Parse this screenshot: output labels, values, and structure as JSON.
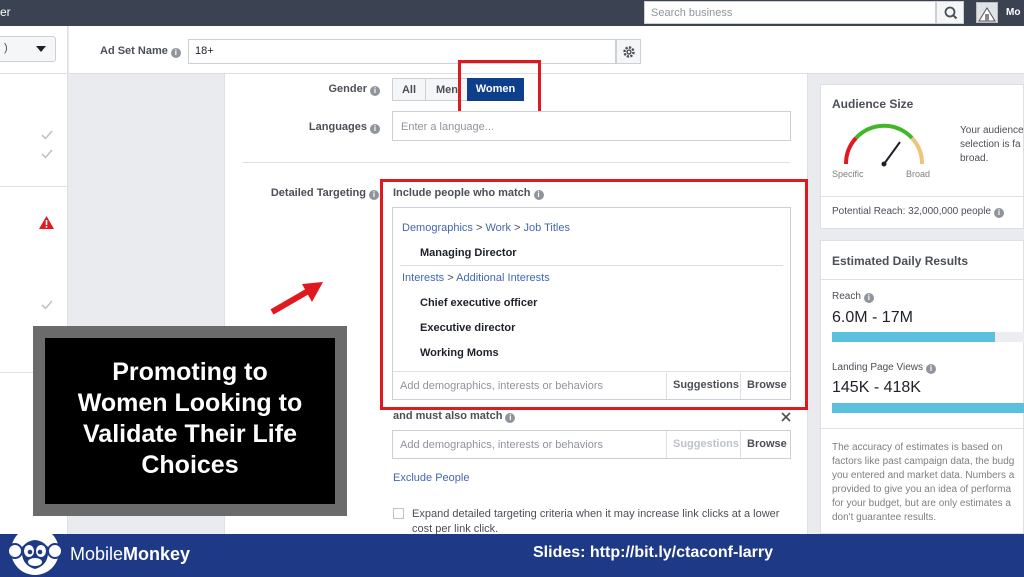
{
  "topbar": {
    "brand_fragment": "er",
    "search_placeholder": "Search business",
    "user_fragment": "Mo"
  },
  "adset": {
    "label": "Ad Set Name",
    "value": "18+"
  },
  "gender": {
    "label": "Gender",
    "options": [
      "All",
      "Men",
      "Women"
    ],
    "selected": "Women"
  },
  "languages": {
    "label": "Languages",
    "placeholder": "Enter a language..."
  },
  "detailed_targeting": {
    "label": "Detailed Targeting",
    "include_label": "Include people who match",
    "demo_path": [
      "Demographics",
      "Work",
      "Job Titles"
    ],
    "demo_items": [
      "Managing Director"
    ],
    "interest_path": [
      "Interests",
      "Additional Interests"
    ],
    "interest_items": [
      "Chief executive officer",
      "Executive director",
      "Working Moms"
    ],
    "add_placeholder": "Add demographics, interests or behaviors",
    "suggestions": "Suggestions",
    "browse": "Browse",
    "must_also_label": "and must also match",
    "exclude_link": "Exclude People",
    "expand_text": "Expand detailed targeting criteria when it may increase link clicks at a lower cost per link click."
  },
  "audience_size": {
    "title": "Audience Size",
    "gauge_specific": "Specific",
    "gauge_broad": "Broad",
    "description": "Your audience selection is fa broad.",
    "desc_lines": [
      "Your audience",
      "selection is fa",
      "broad."
    ],
    "potential_reach": "Potential Reach: 32,000,000 people"
  },
  "daily_results": {
    "title": "Estimated Daily Results",
    "reach_label": "Reach",
    "reach_value": "6.0M - 17M",
    "reach_fill": 0.85,
    "lpv_label": "Landing Page Views",
    "lpv_value": "145K - 418K",
    "lpv_fill": 1.0,
    "disclaimer_lines": [
      "The accuracy of estimates is based on",
      "factors like past campaign data, the budg",
      "you entered and market data. Numbers a",
      "provided to give you an idea of performa",
      "for your budget, but are only estimates a",
      "don't guarantee results."
    ]
  },
  "overlay": {
    "lines": [
      "Promoting to",
      "Women Looking to",
      "Validate Their Life",
      "Choices"
    ]
  },
  "banner": {
    "brand_a": "Mobile",
    "brand_b": "Monkey",
    "slides": "Slides: http://bit.ly/ctaconf-larry"
  },
  "colors": {
    "highlight_red": "#e0191e",
    "selected_blue": "#0e3f8a",
    "link_blue": "#4267b2",
    "bar_blue": "#5bc0de",
    "banner_navy": "#1e3a86"
  }
}
